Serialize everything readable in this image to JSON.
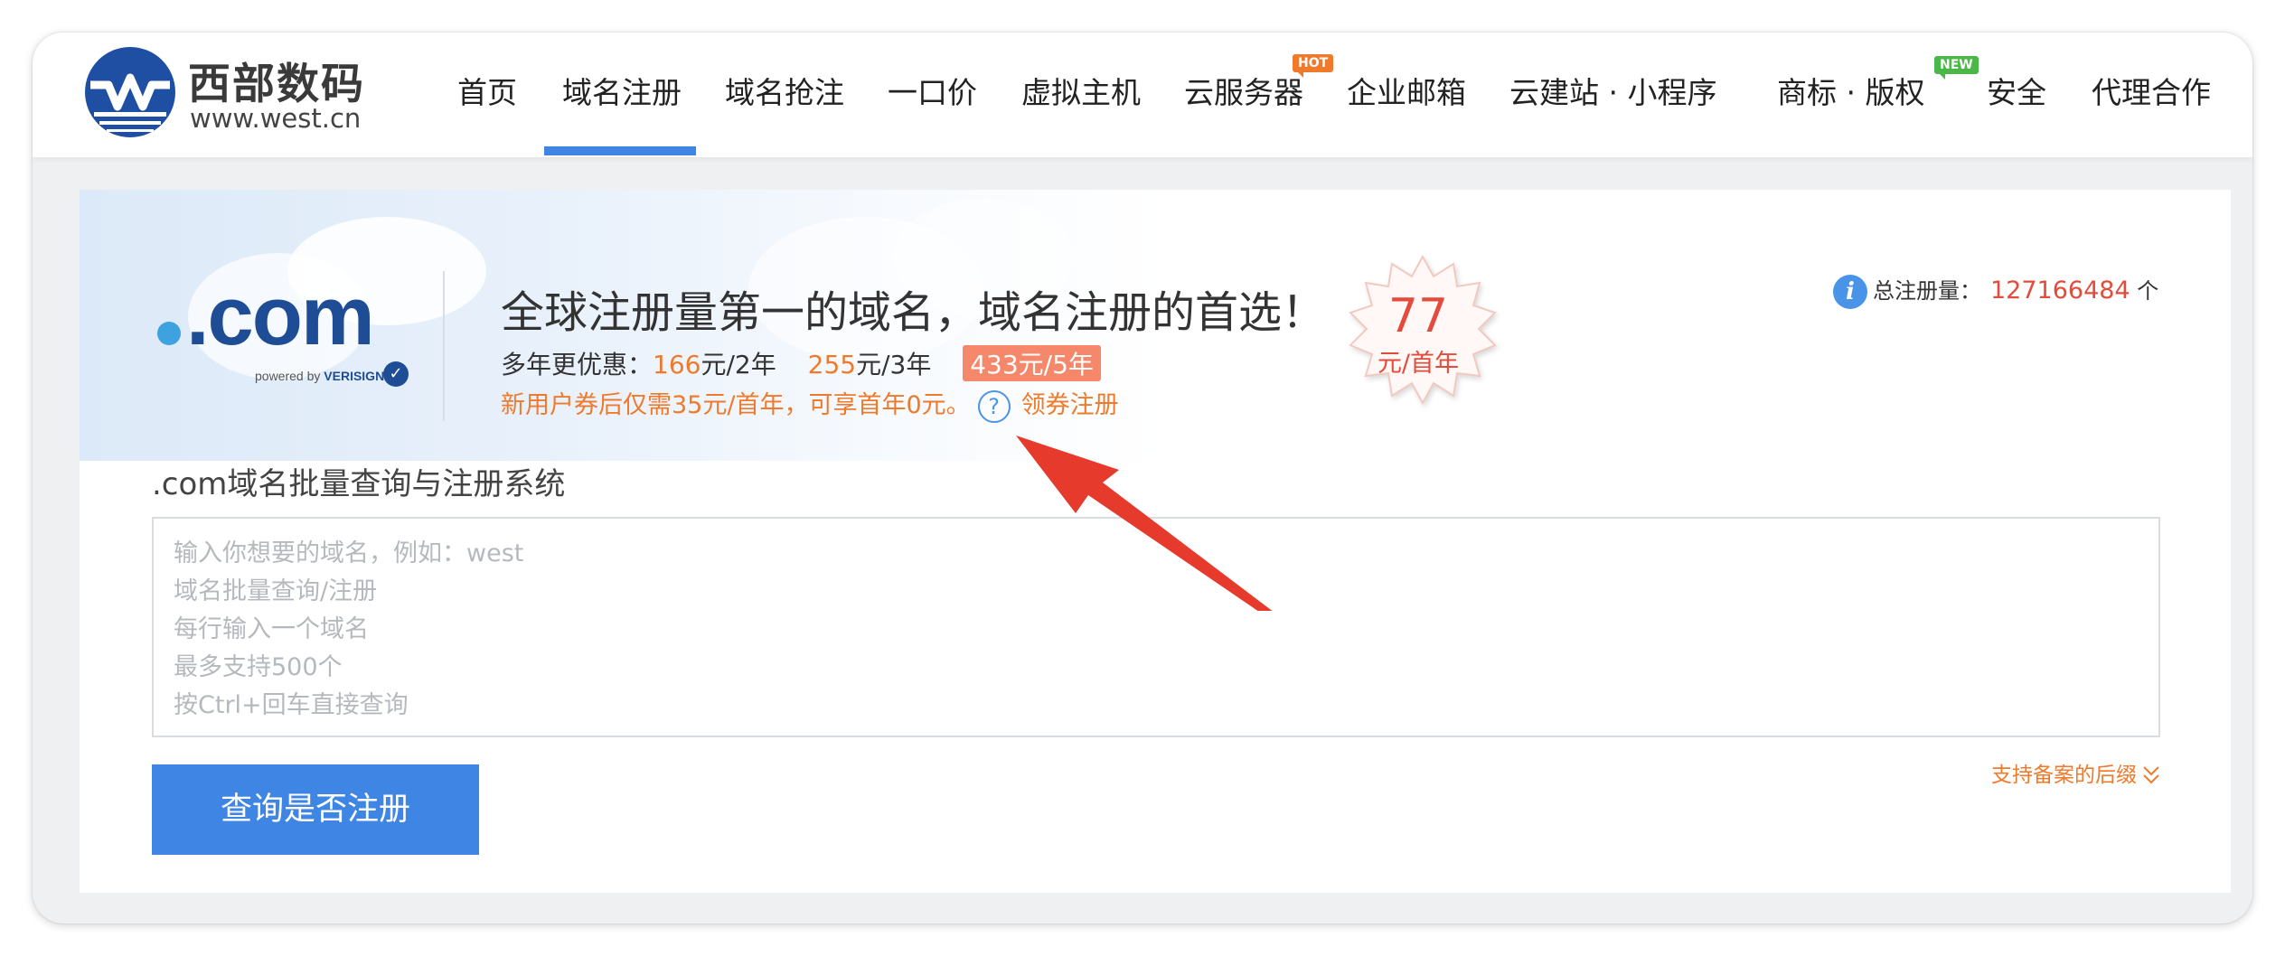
{
  "brand": {
    "name": "西部数码",
    "url": "www.west.cn"
  },
  "nav": {
    "items": [
      {
        "label": "首页"
      },
      {
        "label": "域名注册",
        "active": true
      },
      {
        "label": "域名抢注"
      },
      {
        "label": "一口价"
      },
      {
        "label": "虚拟主机"
      },
      {
        "label": "云服务器",
        "badge": "HOT"
      },
      {
        "label": "企业邮箱"
      },
      {
        "label": "云建站 · 小程序"
      },
      {
        "label": "商标 · 版权",
        "badge": "NEW"
      },
      {
        "label": "安全"
      },
      {
        "label": "代理合作"
      }
    ]
  },
  "hero": {
    "tld": ".com",
    "powered_by": "powered by",
    "powered_brand": "VERISIGN",
    "headline": "全球注册量第一的域名，域名注册的首选！",
    "price_intro": "多年更优惠：",
    "price_2y_value": "166",
    "price_2y_unit": "元/2年",
    "price_3y_value": "255",
    "price_3y_unit": "元/3年",
    "price_5y": "433元/5年",
    "promo_text": "新用户券后仅需35元/首年，可享首年0元。",
    "coupon_link": "领券注册",
    "first_year_price": "77",
    "first_year_unit": "元/首年",
    "total_label": "总注册量：",
    "total_count": "127166484",
    "total_unit": "个"
  },
  "query": {
    "title": ".com域名批量查询与注册系统",
    "placeholder_lines": [
      "输入你想要的域名，例如：west",
      "域名批量查询/注册",
      "每行输入一个域名",
      "最多支持500个",
      "按Ctrl+回车直接查询"
    ],
    "suffix_link": "支持备案的后缀",
    "button_label": "查询是否注册"
  },
  "colors": {
    "accent_blue": "#3f86e4",
    "orange": "#f07a2c",
    "red": "#e34b3b",
    "annotation_arrow": "#e53a2c"
  }
}
